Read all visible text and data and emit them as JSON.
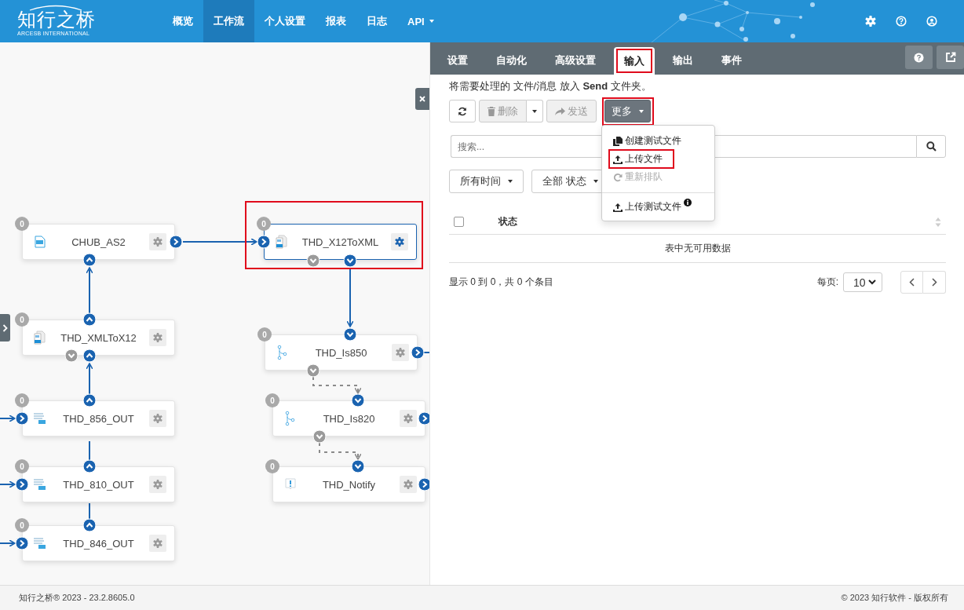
{
  "header": {
    "logo": {
      "name": "知行之桥",
      "tagline": "ARCESB INTERNATIONAL"
    },
    "nav": [
      {
        "label": "概览",
        "selected": false,
        "dropdown": false
      },
      {
        "label": "工作流",
        "selected": true,
        "dropdown": false
      },
      {
        "label": "个人设置",
        "selected": false,
        "dropdown": false
      },
      {
        "label": "报表",
        "selected": false,
        "dropdown": false
      },
      {
        "label": "日志",
        "selected": false,
        "dropdown": false
      },
      {
        "label": "API",
        "selected": false,
        "dropdown": true
      }
    ]
  },
  "canvas": {
    "nodes": [
      {
        "count": "0",
        "name": "CHUB_AS2",
        "kind": "as2",
        "selected": false,
        "highlighted": false
      },
      {
        "count": "0",
        "name": "THD_X12ToXML",
        "kind": "x12",
        "selected": true,
        "highlighted": true
      },
      {
        "count": "0",
        "name": "THD_XMLToX12",
        "kind": "x12",
        "selected": false,
        "highlighted": false
      },
      {
        "count": "0",
        "name": "THD_Is850",
        "kind": "branch",
        "selected": false,
        "highlighted": false
      },
      {
        "count": "0",
        "name": "THD_856_OUT",
        "kind": "edi",
        "selected": false,
        "highlighted": false
      },
      {
        "count": "0",
        "name": "THD_Is820",
        "kind": "branch",
        "selected": false,
        "highlighted": false
      },
      {
        "count": "0",
        "name": "THD_810_OUT",
        "kind": "edi",
        "selected": false,
        "highlighted": false
      },
      {
        "count": "0",
        "name": "THD_Notify",
        "kind": "notify",
        "selected": false,
        "highlighted": false
      },
      {
        "count": "0",
        "name": "THD_846_OUT",
        "kind": "edi",
        "selected": false,
        "highlighted": false
      }
    ]
  },
  "panel": {
    "tabs": [
      {
        "label": "设置",
        "selected": false,
        "highlighted": false
      },
      {
        "label": "自动化",
        "selected": false,
        "highlighted": false
      },
      {
        "label": "高级设置",
        "selected": false,
        "highlighted": false
      },
      {
        "label": "输入",
        "selected": true,
        "highlighted": true
      },
      {
        "label": "输出",
        "selected": false,
        "highlighted": false
      },
      {
        "label": "事件",
        "selected": false,
        "highlighted": false
      }
    ],
    "description": "将需要处理的 文件/消息 放入 **Send** 文件夹。",
    "toolbar": {
      "delete": {
        "label": "删除",
        "disabled": true
      },
      "send": {
        "label": "发送",
        "disabled": true
      },
      "more": {
        "label": "更多",
        "highlighted": true
      }
    },
    "menu": [
      {
        "label": "创建测试文件",
        "kind": "copy",
        "disabled": false,
        "highlighted": false,
        "info": false
      },
      {
        "label": "上传文件",
        "kind": "upload",
        "disabled": false,
        "highlighted": true,
        "info": false
      },
      {
        "label": "重新排队",
        "kind": "redo",
        "disabled": true,
        "highlighted": false,
        "info": false
      },
      {
        "kind": "divider"
      },
      {
        "label": "上传测试文件",
        "kind": "upload",
        "disabled": false,
        "highlighted": false,
        "info": true
      }
    ],
    "search": {
      "placeholder": "搜索..."
    },
    "filters": [
      "所有时间",
      "全部 状态"
    ],
    "table": {
      "select_all_checked": false,
      "columns": [
        "状态"
      ],
      "empty_message": "表中无可用数据"
    },
    "info": "显示 0 到 0，共 0 个条目",
    "per_page": {
      "label": "每页:",
      "value": "10"
    }
  },
  "footer": {
    "left": "知行之桥® 2023 - 23.2.8605.0",
    "right": "© 2023 知行软件 - 版权所有"
  }
}
